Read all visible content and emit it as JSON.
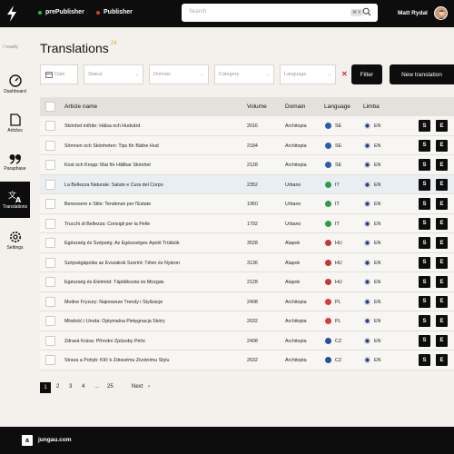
{
  "header": {
    "nav": [
      {
        "label": "prePublisher",
        "color": "#2db84d"
      },
      {
        "label": "Publisher",
        "color": "#e53935"
      }
    ],
    "search_placeholder": "Search",
    "search_shortcut": "⌘ K",
    "user_name": "Matt Rydal"
  },
  "sidebar": {
    "breadcrumb": "/ ready",
    "items": [
      {
        "label": "Dashboard",
        "icon": "gauge-icon"
      },
      {
        "label": "Articles",
        "icon": "document-icon"
      },
      {
        "label": "Paraphase",
        "icon": "quote-icon"
      },
      {
        "label": "Translations",
        "icon": "translate-icon",
        "active": true
      },
      {
        "label": "Settings",
        "icon": "gear-icon"
      }
    ]
  },
  "page": {
    "title": "Translations",
    "count": "24"
  },
  "filters": {
    "date": "Date",
    "status": "Status",
    "domain": "Domain",
    "category": "Category",
    "language": "Language",
    "filter_button": "Filter",
    "new_button": "New translation"
  },
  "table": {
    "headers": [
      "Article name",
      "Volume",
      "Domain",
      "Language",
      "Limba"
    ],
    "rows": [
      {
        "name": "Skönhet inifrån: Hälsa och Hudvård",
        "volume": "2016",
        "domain": "Architopia",
        "lang": "SE",
        "flag": "#2a5db0",
        "limba": "EN"
      },
      {
        "name": "Sömnen och Skönheten: Tips för Bättre Hud",
        "volume": "2184",
        "domain": "Architopia",
        "lang": "SE",
        "flag": "#2a5db0",
        "limba": "EN"
      },
      {
        "name": "Kost och Kropp: Mat för Hållbar Skönhet",
        "volume": "2128",
        "domain": "Architopia",
        "lang": "SE",
        "flag": "#2a5db0",
        "limba": "EN"
      },
      {
        "name": "La Bellezza Naturale: Salute e Cura del Corpo",
        "volume": "2352",
        "domain": "Urbano",
        "lang": "IT",
        "flag": "#2e9b4a",
        "limba": "EN",
        "highlight": true
      },
      {
        "name": "Benessere e Stile: Tendenze per l'Estate",
        "volume": "1960",
        "domain": "Urbano",
        "lang": "IT",
        "flag": "#2e9b4a",
        "limba": "EN"
      },
      {
        "name": "Trucchi di Bellezza: Consigli per la Pelle",
        "volume": "1792",
        "domain": "Urbano",
        "lang": "IT",
        "flag": "#2e9b4a",
        "limba": "EN"
      },
      {
        "name": "Egészség és Szépség: Az Egészséges Ápoló Trükkök",
        "volume": "3528",
        "domain": "Alapok",
        "lang": "HU",
        "flag": "#c8323a",
        "limba": "EN"
      },
      {
        "name": "Szépségápolás az Évszakok Szerint: Télen és Nyáron",
        "volume": "3136",
        "domain": "Alapok",
        "lang": "HU",
        "flag": "#c8323a",
        "limba": "EN"
      },
      {
        "name": "Egészség és Életmód: Táplálkozás és Mozgás",
        "volume": "2128",
        "domain": "Alapok",
        "lang": "HU",
        "flag": "#c8323a",
        "limba": "EN"
      },
      {
        "name": "Modne Fryzury: Najnowsze Trendy i Stylizacje",
        "volume": "2408",
        "domain": "Architopia",
        "lang": "PL",
        "flag": "#d83b3b",
        "limba": "EN"
      },
      {
        "name": "Młodość i Uroda: Optymalna Pielęgnacja Skóry",
        "volume": "2632",
        "domain": "Architopia",
        "lang": "PL",
        "flag": "#d83b3b",
        "limba": "EN"
      },
      {
        "name": "Zdravá Krása: Přírodní Způsoby Péče",
        "volume": "2408",
        "domain": "Architopia",
        "lang": "CZ",
        "flag": "#2b4fa0",
        "limba": "EN"
      },
      {
        "name": "Strava a Pohyb: Klíč k Zdravému Životnímu Stylu",
        "volume": "2632",
        "domain": "Architopia",
        "lang": "CZ",
        "flag": "#2b4fa0",
        "limba": "EN"
      }
    ],
    "action_s": "S",
    "action_e": "E"
  },
  "pagination": {
    "pages": [
      "1",
      "2",
      "3",
      "4",
      "...",
      "25"
    ],
    "next": "Next",
    "next_arrow": "›"
  },
  "footer": {
    "logo": "a",
    "text": "jungau.com"
  }
}
